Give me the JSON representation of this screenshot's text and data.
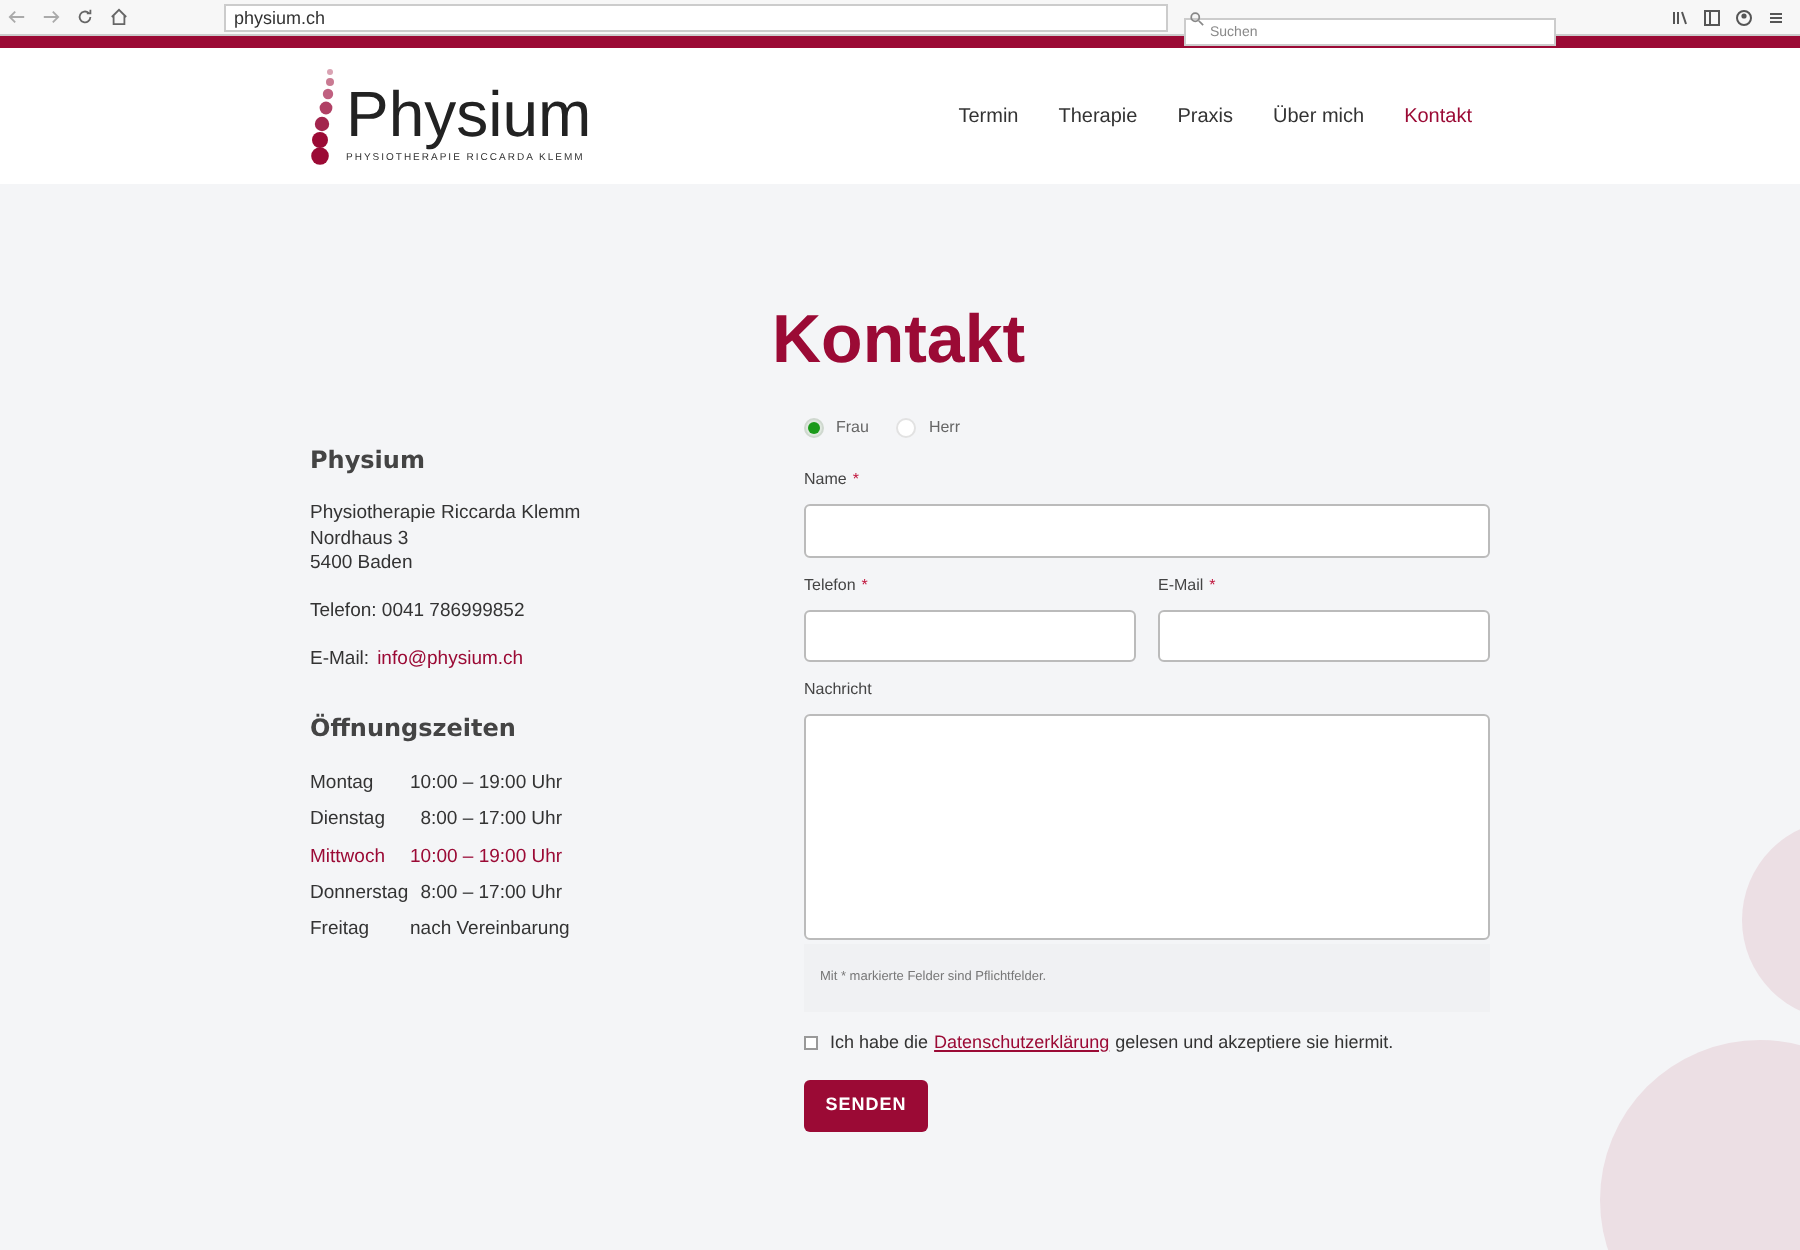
{
  "browser": {
    "url": "physium.ch",
    "search_placeholder": "Suchen"
  },
  "logo": {
    "name": "Physium",
    "tagline": "PHYSIOTHERAPIE RICCARDA KLEMM"
  },
  "nav": [
    {
      "label": "Termin",
      "selected": false
    },
    {
      "label": "Therapie",
      "selected": false
    },
    {
      "label": "Praxis",
      "selected": false
    },
    {
      "label": "Über mich",
      "selected": false
    },
    {
      "label": "Kontakt",
      "selected": true
    }
  ],
  "page_title": "Kontakt",
  "contact": {
    "heading": "Physium",
    "address": [
      "Physiotherapie Riccarda Klemm",
      "Nordhaus 3",
      "5400 Baden"
    ],
    "phone": "Telefon: 0041 786999852",
    "email_label": "E-Mail:",
    "email": "info@physium.ch"
  },
  "hours": {
    "heading": "Öffnungszeiten",
    "rows": [
      {
        "day": "Montag",
        "time": "10:00 – 19:00 Uhr",
        "selected": false
      },
      {
        "day": "Dienstag",
        "time": "8:00 – 17:00 Uhr",
        "selected": false
      },
      {
        "day": "Mittwoch",
        "time": "10:00 – 19:00 Uhr",
        "selected": true
      },
      {
        "day": "Donnerstag",
        "time": "8:00 – 17:00 Uhr",
        "selected": false
      },
      {
        "day": "Freitag",
        "time": "nach Vereinbarung",
        "selected": false
      }
    ]
  },
  "form": {
    "salutation": [
      {
        "label": "Frau",
        "selected": true
      },
      {
        "label": "Herr",
        "selected": false
      }
    ],
    "name": {
      "label": "Name",
      "mark": "*"
    },
    "phone": {
      "label": "Telefon",
      "mark": "*"
    },
    "email": {
      "label": "E-Mail",
      "mark": "*"
    },
    "message": {
      "label": "Nachricht"
    },
    "note": "Mit * markierte Felder sind Pflichtfelder.",
    "consent": {
      "checked": false,
      "before": "Ich habe die",
      "link": "Datenschutzerklärung",
      "after": "gelesen und akzeptiere sie hiermit."
    },
    "submit": "SENDEN"
  }
}
